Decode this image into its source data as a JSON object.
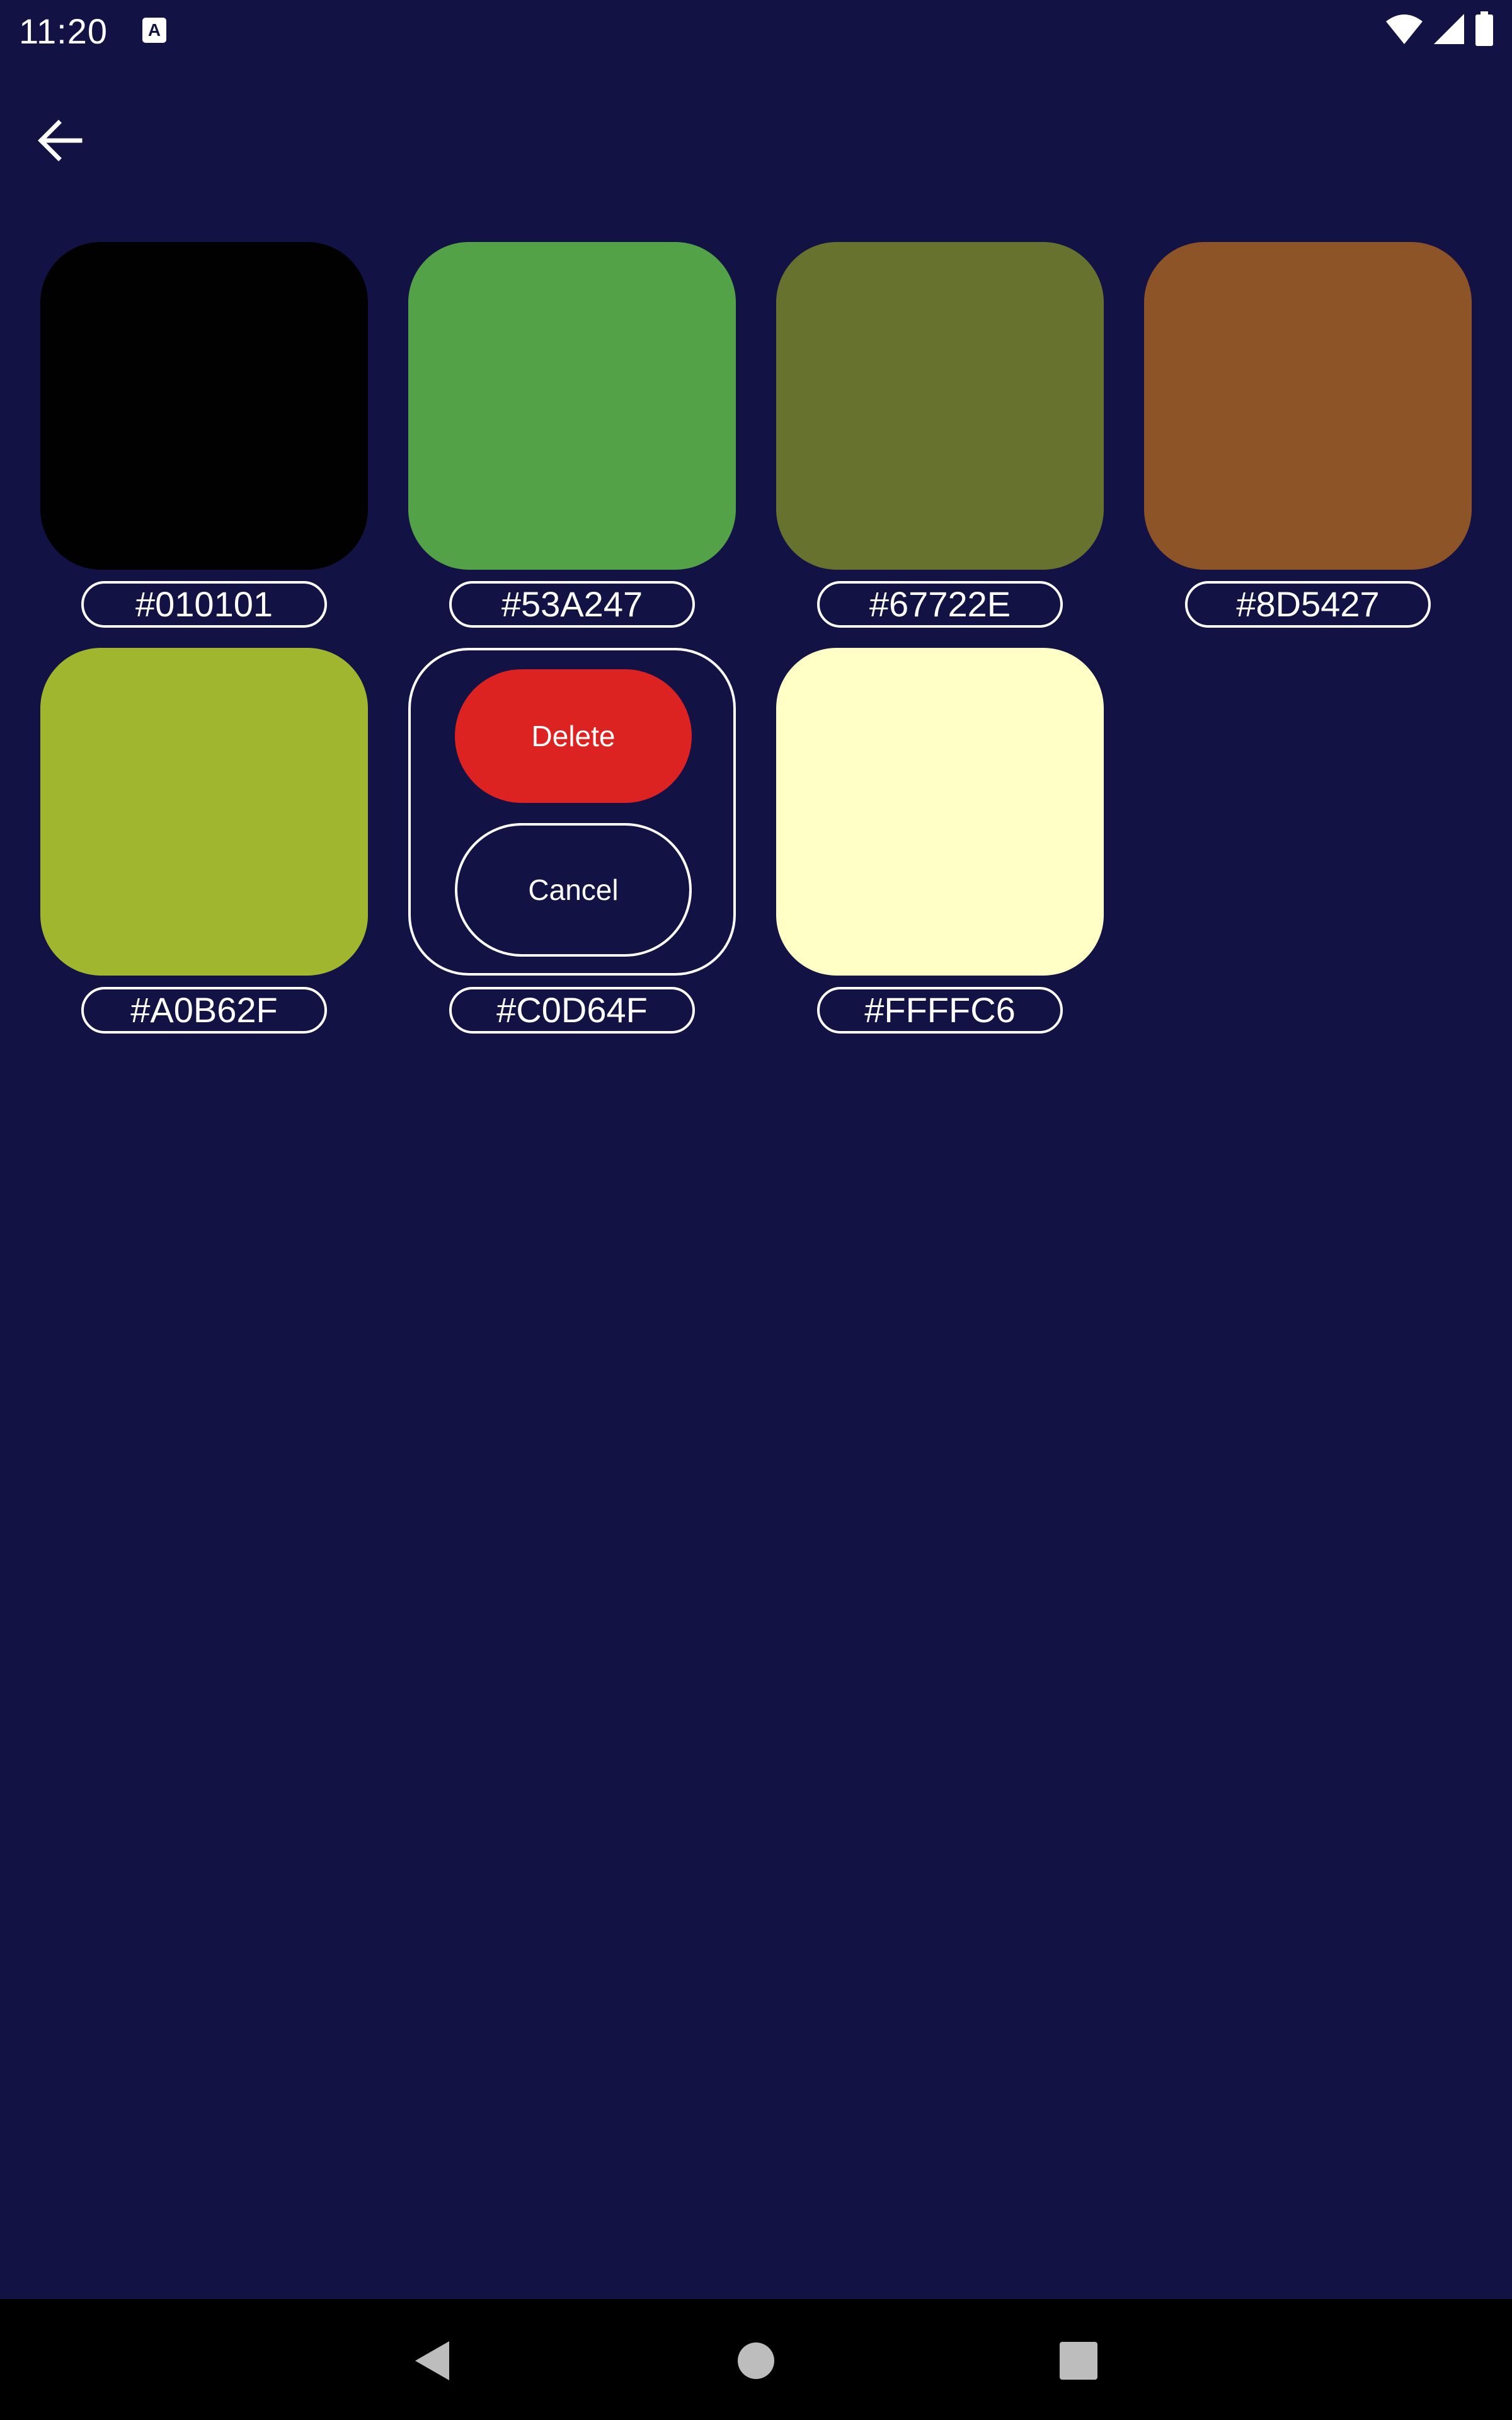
{
  "status_bar": {
    "time": "11:20",
    "notification_icon": "a-icon",
    "icons": [
      "wifi-icon",
      "signal-icon",
      "battery-icon"
    ]
  },
  "toolbar": {
    "back_icon": "arrow-left-icon"
  },
  "swatches": [
    {
      "hex": "#010101",
      "color": "#010101"
    },
    {
      "hex": "#53A247",
      "color": "#53A247"
    },
    {
      "hex": "#67722E",
      "color": "#67722E"
    },
    {
      "hex": "#8D5427",
      "color": "#8D5427"
    },
    {
      "hex": "#A0B62F",
      "color": "#A0B62F"
    },
    {
      "hex": "#C0D64F",
      "color": "#C0D64F"
    },
    {
      "hex": "#FFFFC6",
      "color": "#FFFFC6"
    }
  ],
  "action_tile": {
    "delete_label": "Delete",
    "cancel_label": "Cancel",
    "delete_color": "#DD2222"
  },
  "nav_bar": {
    "back": "nav-back-icon",
    "home": "nav-home-icon",
    "recents": "nav-recents-icon"
  },
  "colors": {
    "background": "#121244",
    "nav_background": "#000000",
    "outline": "#FFFFFF"
  }
}
